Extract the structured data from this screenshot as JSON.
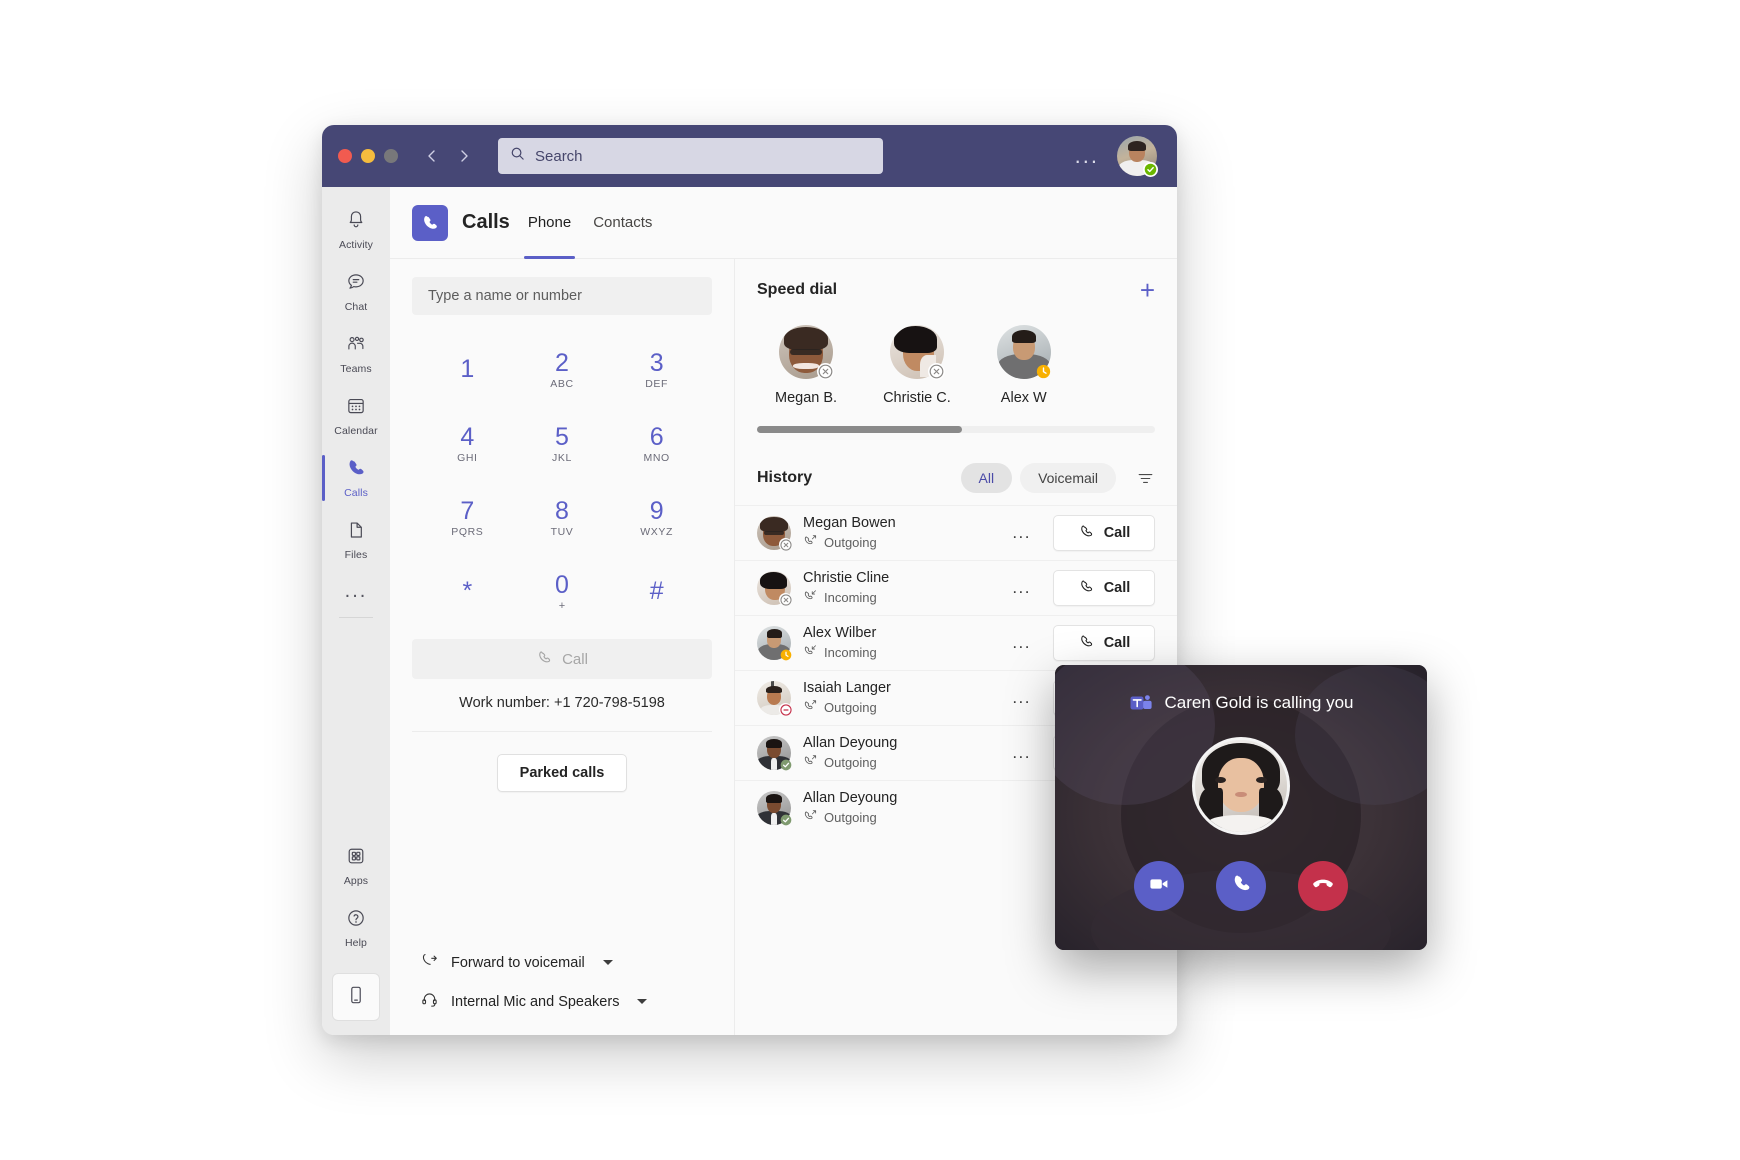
{
  "window": {
    "traffic_lights": [
      "close",
      "minimize",
      "zoom"
    ]
  },
  "titlebar": {
    "back_label": "Back",
    "forward_label": "Forward",
    "search_placeholder": "Search",
    "search_value": "",
    "more_label": "...",
    "profile_status": "available"
  },
  "rail": {
    "items": [
      {
        "label": "Activity",
        "icon": "bell-icon",
        "active": false
      },
      {
        "label": "Chat",
        "icon": "chat-icon",
        "active": false
      },
      {
        "label": "Teams",
        "icon": "teams-icon",
        "active": false
      },
      {
        "label": "Calendar",
        "icon": "calendar-icon",
        "active": false
      },
      {
        "label": "Calls",
        "icon": "phone-icon",
        "active": true
      },
      {
        "label": "Files",
        "icon": "file-icon",
        "active": false
      }
    ],
    "more_label": "...",
    "bottom_items": [
      {
        "label": "Apps",
        "icon": "apps-icon"
      },
      {
        "label": "Help",
        "icon": "help-icon"
      }
    ],
    "device_button_icon": "mobile-device-icon"
  },
  "header": {
    "app_icon": "phone-icon",
    "title": "Calls",
    "tabs": [
      {
        "label": "Phone",
        "active": true
      },
      {
        "label": "Contacts",
        "active": false
      }
    ]
  },
  "dialer": {
    "input_placeholder": "Type a name or number",
    "input_value": "",
    "keys": [
      {
        "num": "1",
        "sub": ""
      },
      {
        "num": "2",
        "sub": "ABC"
      },
      {
        "num": "3",
        "sub": "DEF"
      },
      {
        "num": "4",
        "sub": "GHI"
      },
      {
        "num": "5",
        "sub": "JKL"
      },
      {
        "num": "6",
        "sub": "MNO"
      },
      {
        "num": "7",
        "sub": "PQRS"
      },
      {
        "num": "8",
        "sub": "TUV"
      },
      {
        "num": "9",
        "sub": "WXYZ"
      },
      {
        "num": "*",
        "sub": ""
      },
      {
        "num": "0",
        "sub": "+"
      },
      {
        "num": "#",
        "sub": ""
      }
    ],
    "call_button_label": "Call",
    "call_button_enabled": false,
    "work_number_label": "Work number: +1 720-798-5198",
    "parked_calls_label": "Parked calls",
    "footer": [
      {
        "label": "Forward to voicemail",
        "icon": "call-forward-icon",
        "has_caret": true
      },
      {
        "label": "Internal Mic and Speakers",
        "icon": "headset-icon",
        "has_caret": true
      }
    ]
  },
  "speed_dial": {
    "title": "Speed dial",
    "add_label": "+",
    "contacts": [
      {
        "name": "Megan B.",
        "status": "offline"
      },
      {
        "name": "Christie C.",
        "status": "offline"
      },
      {
        "name": "Alex W",
        "status": "away"
      }
    ]
  },
  "history": {
    "title": "History",
    "filters": [
      {
        "label": "All",
        "active": true
      },
      {
        "label": "Voicemail",
        "active": false
      }
    ],
    "filter_icon": "filter-icon",
    "call_button_label": "Call",
    "more_label": "...",
    "rows": [
      {
        "name": "Megan Bowen",
        "direction": "Outgoing",
        "status": "offline"
      },
      {
        "name": "Christie Cline",
        "direction": "Incoming",
        "status": "offline"
      },
      {
        "name": "Alex Wilber",
        "direction": "Incoming",
        "status": "away"
      },
      {
        "name": "Isaiah Langer",
        "direction": "Outgoing",
        "status": "busy"
      },
      {
        "name": "Allan Deyoung",
        "direction": "Outgoing",
        "status": "available"
      },
      {
        "name": "Allan Deyoung",
        "direction": "Outgoing",
        "status": "available"
      }
    ]
  },
  "toast": {
    "app_icon": "teams-logo-icon",
    "title": "Caren Gold is calling you",
    "caller_name": "Caren Gold",
    "actions": [
      {
        "name": "accept-video",
        "icon": "video-icon",
        "color": "#5b5fc7"
      },
      {
        "name": "accept-audio",
        "icon": "phone-icon",
        "color": "#5b5fc7"
      },
      {
        "name": "decline",
        "icon": "decline-phone-icon",
        "color": "#c4314b"
      }
    ]
  },
  "colors": {
    "brand_purple": "#5b5fc7",
    "titlebar": "#464775",
    "decline_red": "#c4314b",
    "available_green": "#6bb700",
    "away_yellow": "#f8b000",
    "busy_red": "#c4314b"
  }
}
